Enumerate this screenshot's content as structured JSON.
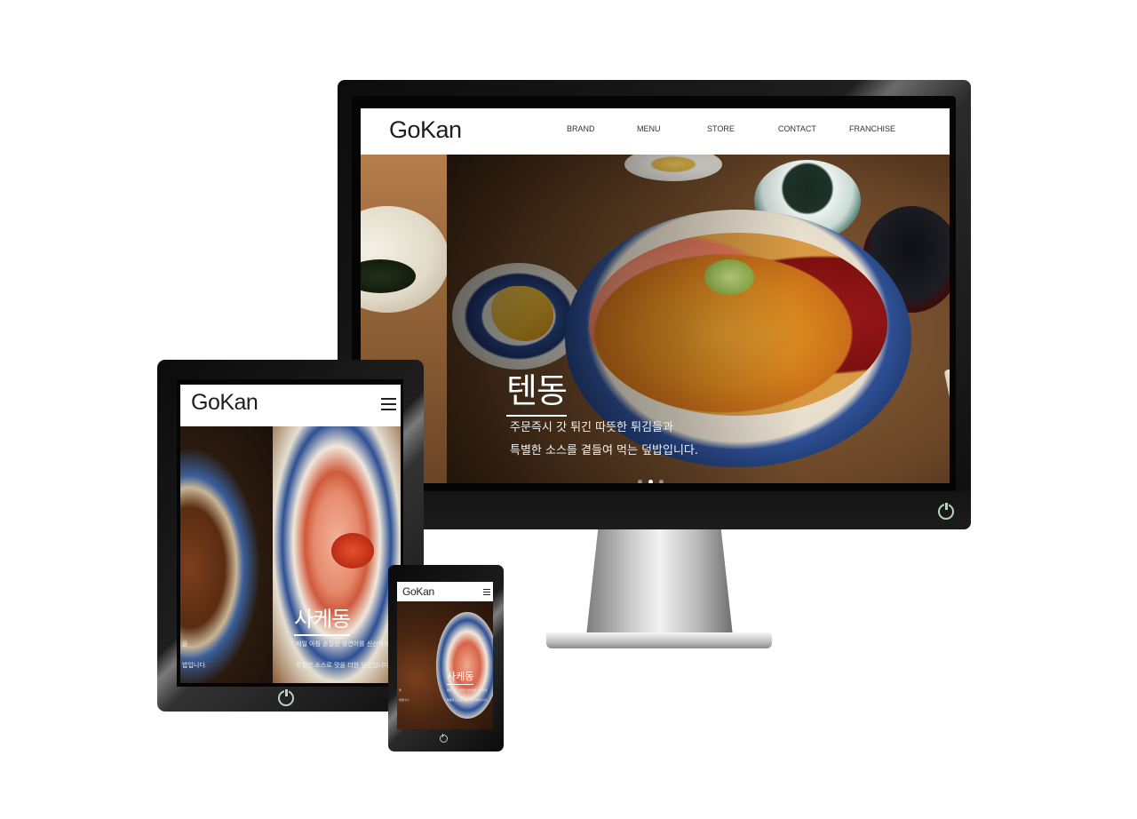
{
  "site": {
    "logo": "GoKan",
    "nav": [
      "BRAND",
      "MENU",
      "STORE",
      "CONTACT",
      "FRANCHISE"
    ]
  },
  "desktop": {
    "hero_title": "텐동",
    "hero_line1": "주문즉시 갓 튀긴 따뜻한 튀김들과",
    "hero_line2": "특별한 소스를 곁들여 먹는 덮밥입니다.",
    "slider_dots": 3,
    "active_dot": 2
  },
  "tablet": {
    "hero_title": "사케동",
    "hero_line1": "매일 아침 손질한 생연어를 신선하게",
    "hero_line2": "특별한 소스로 맛을 더한 덮밥입니다.",
    "left_edge_line1": "을",
    "left_edge_line2": "밥입니다."
  },
  "phone": {
    "hero_title": "사케동"
  },
  "icons": {
    "power": "power-icon",
    "menu": "hamburger-menu-icon"
  }
}
